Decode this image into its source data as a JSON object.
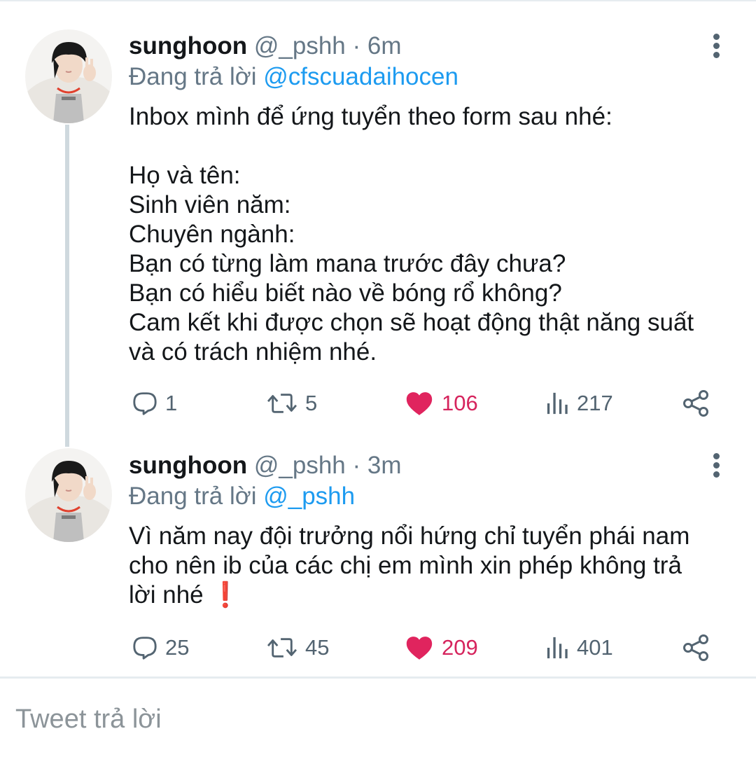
{
  "tweets": [
    {
      "name": "sunghoon",
      "handle": "@_pshh",
      "separator": "·",
      "time": "6m",
      "reply_prefix": "Đang trả lời",
      "reply_to": "@cfscuadaihocen",
      "lines": [
        "Inbox mình để ứng tuyển theo form sau nhé:",
        "",
        "Họ và tên:",
        "Sinh viên năm:",
        "Chuyên ngành:",
        "Bạn có từng làm mana trước đây chưa?",
        "Bạn có hiểu biết nào về bóng rổ không?",
        "Cam kết khi được chọn sẽ hoạt động thật năng suất",
        "và có trách nhiệm nhé."
      ],
      "replies": "1",
      "retweets": "5",
      "likes": "106",
      "views": "217"
    },
    {
      "name": "sunghoon",
      "handle": "@_pshh",
      "separator": "·",
      "time": "3m",
      "reply_prefix": "Đang trả lời",
      "reply_to": "@_pshh",
      "lines": [
        "Vì năm nay đội trưởng nổi hứng chỉ tuyển phái nam",
        "cho nên ib của các chị em mình xin phép không trả",
        "lời nhé ❗"
      ],
      "replies": "25",
      "retweets": "45",
      "likes": "209",
      "views": "401"
    }
  ],
  "reply_box": {
    "placeholder": "Tweet trả lời"
  },
  "colors": {
    "link": "#1d9bf0",
    "like": "#d6245d",
    "muted": "#657786",
    "text": "#14171a"
  },
  "icons": [
    "more-vertical-icon",
    "reply-icon",
    "retweet-icon",
    "heart-icon",
    "views-icon",
    "share-icon"
  ]
}
